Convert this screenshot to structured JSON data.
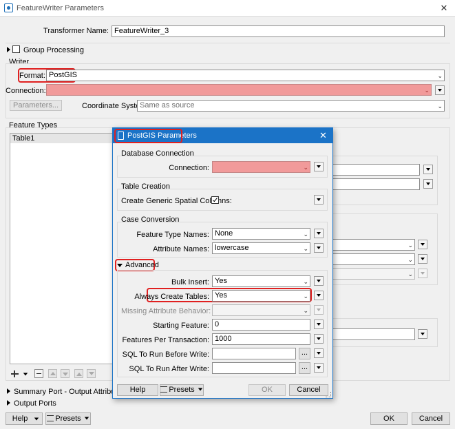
{
  "window": {
    "title": "FeatureWriter Parameters",
    "close_glyph": "✕"
  },
  "transformer": {
    "label": "Transformer Name:",
    "value": "FeatureWriter_3"
  },
  "group_processing": {
    "label": "Group Processing"
  },
  "writer": {
    "section_label": "Writer",
    "format_label": "Format:",
    "format_value": "PostGIS",
    "connection_label": "Connection:",
    "connection_value": "",
    "parameters_button": "Parameters...",
    "coord_label": "Coordinate System:",
    "coord_value": "Same as source"
  },
  "feature_types": {
    "label": "Feature Types",
    "rows": [
      "Table1"
    ]
  },
  "bottom": {
    "summary_port": "Summary Port - Output Attribute Na",
    "output_ports": "Output Ports",
    "help": "Help",
    "presets": "Presets",
    "ok": "OK",
    "cancel": "Cancel"
  },
  "dialog": {
    "title": "PostGIS Parameters",
    "close_glyph": "✕",
    "db_section": "Database Connection",
    "connection_label": "Connection:",
    "table_section": "Table Creation",
    "spatial_label": "Create Generic Spatial Columns:",
    "spatial_checked": true,
    "case_section": "Case Conversion",
    "ftn_label": "Feature Type Names:",
    "ftn_value": "None",
    "attr_label": "Attribute Names:",
    "attr_value": "lowercase",
    "advanced": "Advanced",
    "bulk_label": "Bulk Insert:",
    "bulk_value": "Yes",
    "always_label": "Always Create Tables:",
    "always_value": "Yes",
    "missing_label": "Missing Attribute Behavior:",
    "missing_value": "",
    "start_label": "Starting Feature:",
    "start_value": "0",
    "fpt_label": "Features Per Transaction:",
    "fpt_value": "1000",
    "sql_before_label": "SQL To Run Before Write:",
    "sql_after_label": "SQL To Run After Write:",
    "ellipsis": "...",
    "help": "Help",
    "presets": "Presets",
    "ok": "OK",
    "cancel": "Cancel"
  },
  "colors": {
    "accent": "#1b73c7",
    "required_field": "#f19a9a",
    "highlight": "#e02020"
  }
}
